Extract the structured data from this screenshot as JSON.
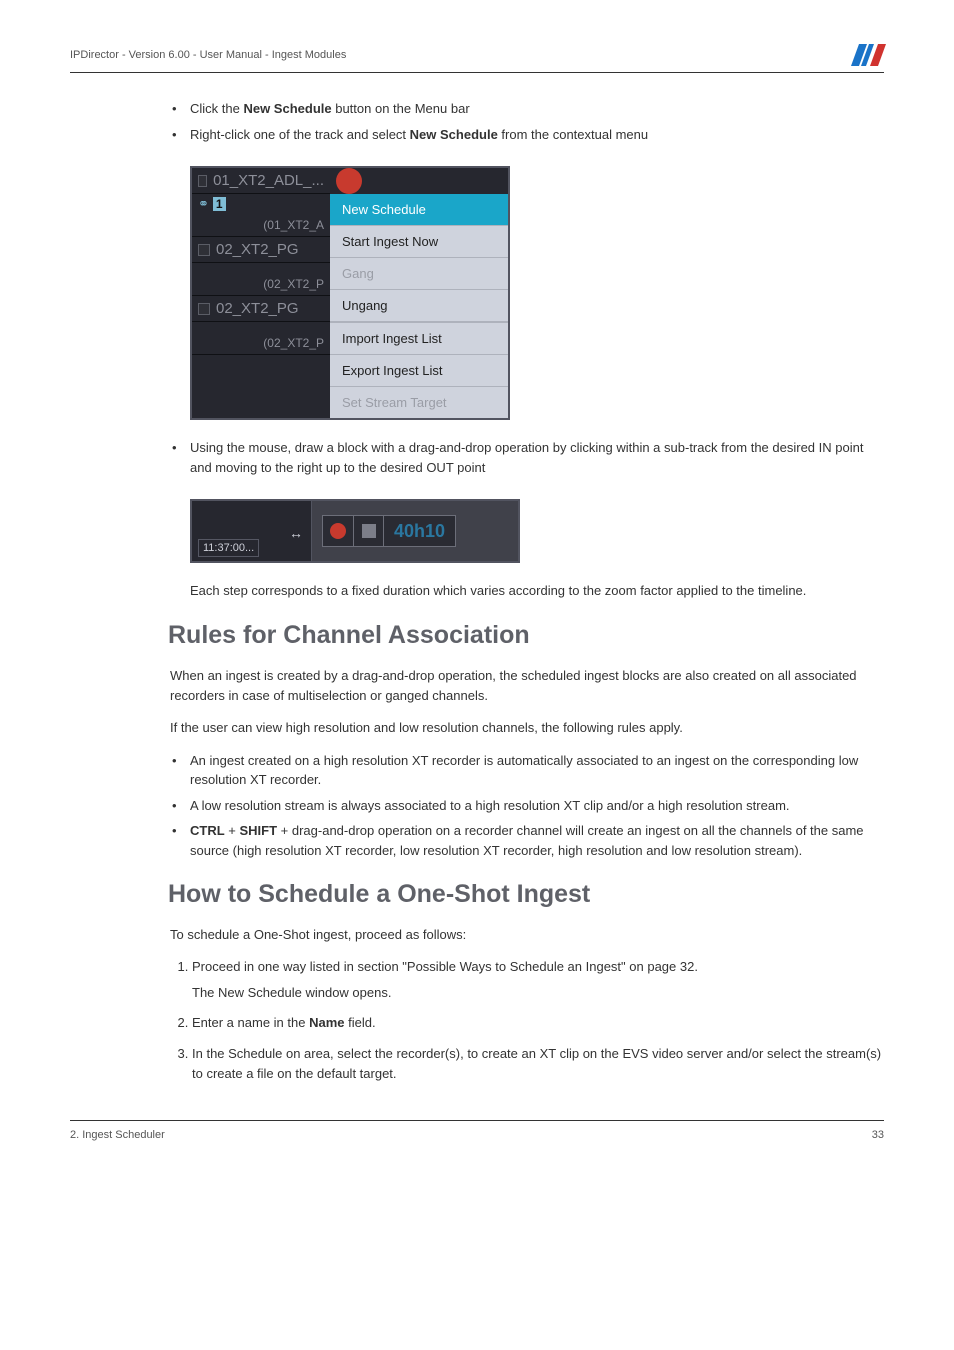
{
  "header": {
    "text": "IPDirector - Version 6.00 - User Manual - Ingest Modules"
  },
  "intro_bullets": [
    {
      "pre": "Click the ",
      "bold": "New Schedule",
      "post": " button on the Menu bar"
    },
    {
      "pre": "Right-click one of the track and select ",
      "bold": "New Schedule",
      "post": " from the contextual menu"
    }
  ],
  "tracks": {
    "t1": "01_XT2_ADL_...",
    "t1_sub": "(01_XT2_A",
    "t2": "02_XT2_PG",
    "t2_sub": "(02_XT2_P",
    "t3": "02_XT2_PG",
    "t3_sub": "(02_XT2_P",
    "chain_num": "1"
  },
  "ctx_menu": {
    "new_schedule": "New Schedule",
    "start_now": "Start Ingest Now",
    "gang": "Gang",
    "ungang": "Ungang",
    "import": "Import Ingest List",
    "export": "Export Ingest List",
    "set_stream": "Set Stream Target"
  },
  "drag_bullet": "Using the mouse, draw a block with a drag-and-drop operation by clicking within a sub-track from the desired IN point and moving to the right up to the desired OUT point",
  "timeline": {
    "time": "11:37:00...",
    "label": "40h10"
  },
  "drag_caption": "Each step corresponds to a fixed duration which varies according to the zoom factor applied to the timeline.",
  "rules_heading": "Rules for Channel Association",
  "rules_p1": "When an ingest is created by a drag-and-drop operation, the scheduled ingest blocks are also created on all associated recorders in case of multiselection or ganged channels.",
  "rules_p2": "If the user can view high resolution and low resolution channels, the following rules apply.",
  "rules_bullets": {
    "b1": "An ingest created on a high resolution XT recorder is automatically associated to an ingest on the corresponding low resolution XT recorder.",
    "b2": "A low resolution stream is always associated to a high resolution XT clip and/or a high resolution stream.",
    "b3_pre": "",
    "b3_k1": "CTRL",
    "b3_plus": " + ",
    "b3_k2": "SHIFT",
    "b3_post": " + drag-and-drop operation on a recorder channel will create an ingest on all the channels of the same source (high resolution XT recorder, low resolution XT recorder, high resolution and low resolution stream)."
  },
  "howto_heading": "How to Schedule a One-Shot Ingest",
  "howto_intro": "To schedule a One-Shot ingest, proceed as follows:",
  "steps": {
    "s1": "Proceed in one way listed in section \"Possible Ways to Schedule an Ingest\" on page 32.",
    "s1_sub": "The New Schedule window opens.",
    "s2_pre": "Enter a name in the ",
    "s2_bold": "Name",
    "s2_post": " field.",
    "s3": "In the Schedule on area, select the recorder(s), to create an XT clip on the EVS video server and/or select the stream(s) to create a file on the default target."
  },
  "footer": {
    "left": "2. Ingest Scheduler",
    "right": "33"
  }
}
